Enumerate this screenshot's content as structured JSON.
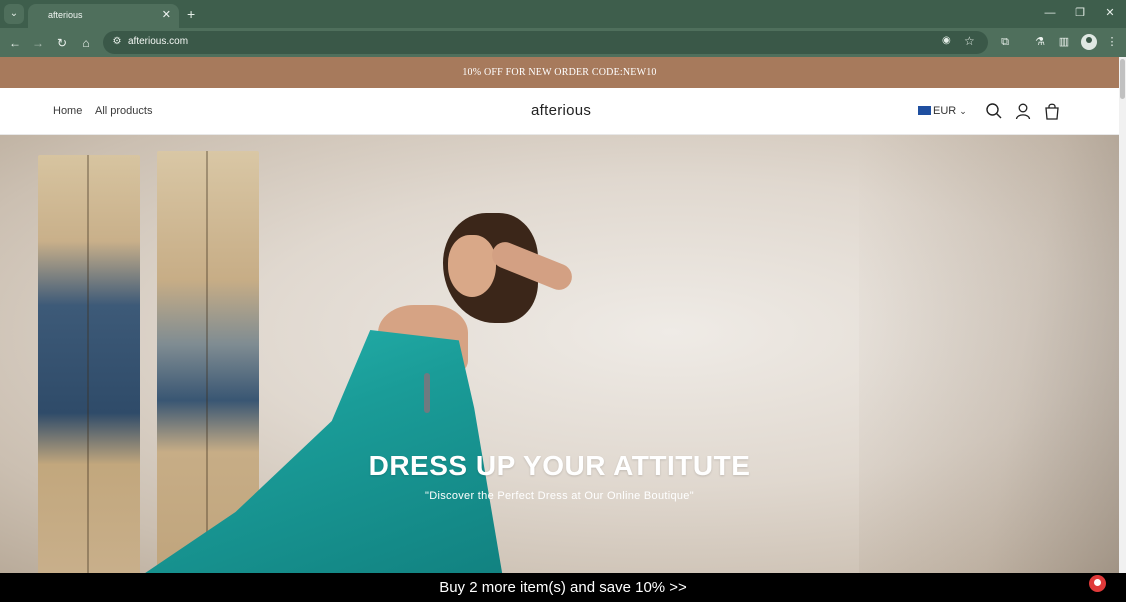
{
  "browser": {
    "tab_title": "afterious",
    "tab_close": "✕",
    "new_tab": "+",
    "url": "afterious.com",
    "window_minimize": "—",
    "window_restore": "❐",
    "window_close": "✕"
  },
  "announcement": "10% OFF FOR NEW ORDER CODE:NEW10",
  "header": {
    "nav": [
      "Home",
      "All products"
    ],
    "logo": "afterious",
    "currency": "EUR"
  },
  "hero": {
    "title": "DRESS UP YOUR ATTITUTE",
    "subtitle": "\"Discover the Perfect Dress at Our Online Boutique\""
  },
  "promo_bar": "Buy 2 more item(s) and save 10%  >>",
  "colors": {
    "chrome": "#4f6f5c",
    "announcement_bg": "#a77a5c",
    "dress": "#1a9c98",
    "promo_bg": "#000000"
  }
}
